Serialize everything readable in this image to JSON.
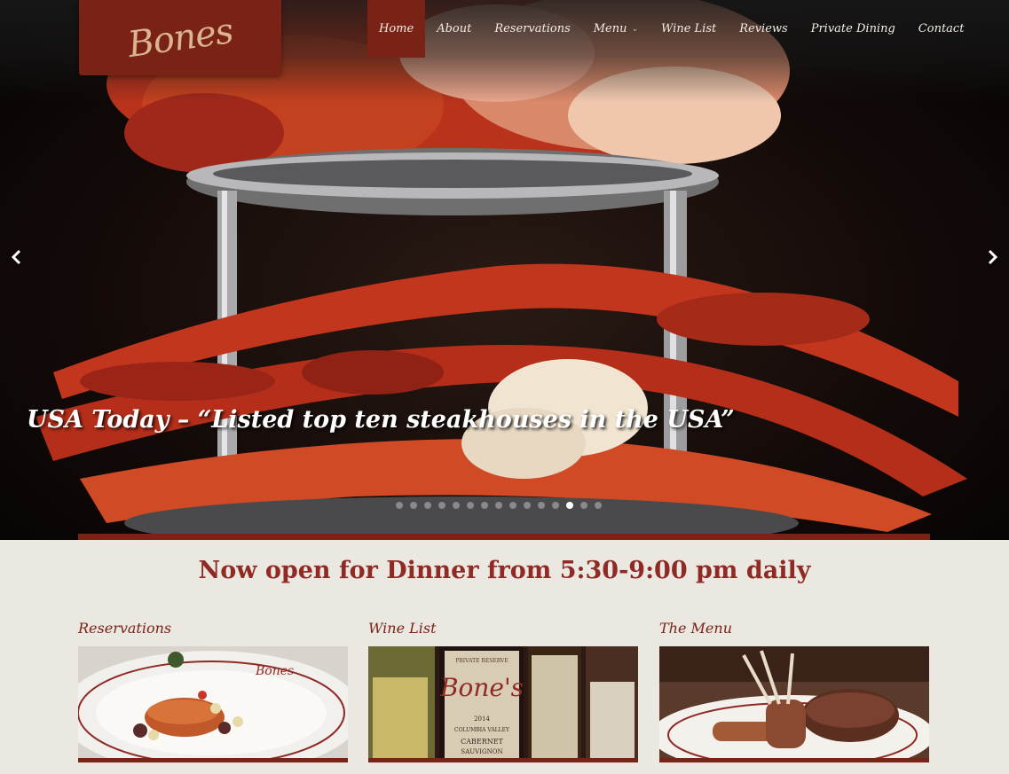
{
  "brand": {
    "logo_text": "Bones"
  },
  "nav": {
    "items": [
      {
        "label": "Home"
      },
      {
        "label": "About"
      },
      {
        "label": "Reservations"
      },
      {
        "label": "Menu"
      },
      {
        "label": "Wine List"
      },
      {
        "label": "Reviews"
      },
      {
        "label": "Private Dining"
      },
      {
        "label": "Contact"
      }
    ],
    "active": "Home",
    "menu_caret": "⌄"
  },
  "slider": {
    "caption": "USA Today – “Listed top ten steakhouses in the USA”",
    "slide_count": 15,
    "active_slide": 12,
    "prev_icon": "chevron-left-icon",
    "next_icon": "chevron-right-icon"
  },
  "headline": "Now open for Dinner from 5:30-9:00 pm daily",
  "cards": [
    {
      "title": "Reservations"
    },
    {
      "title": "Wine List"
    },
    {
      "title": "The Menu"
    }
  ],
  "wine_label": {
    "brand": "Bone's",
    "year": "2014",
    "line1": "PRIVATE RESERVE",
    "line2": "COLUMBIA VALLEY",
    "line3": "CABERNET",
    "line4": "SAUVIGNON"
  },
  "colors": {
    "accent": "#7b2217",
    "headline": "#8f2a25",
    "page_bg": "#ebe7e1"
  }
}
